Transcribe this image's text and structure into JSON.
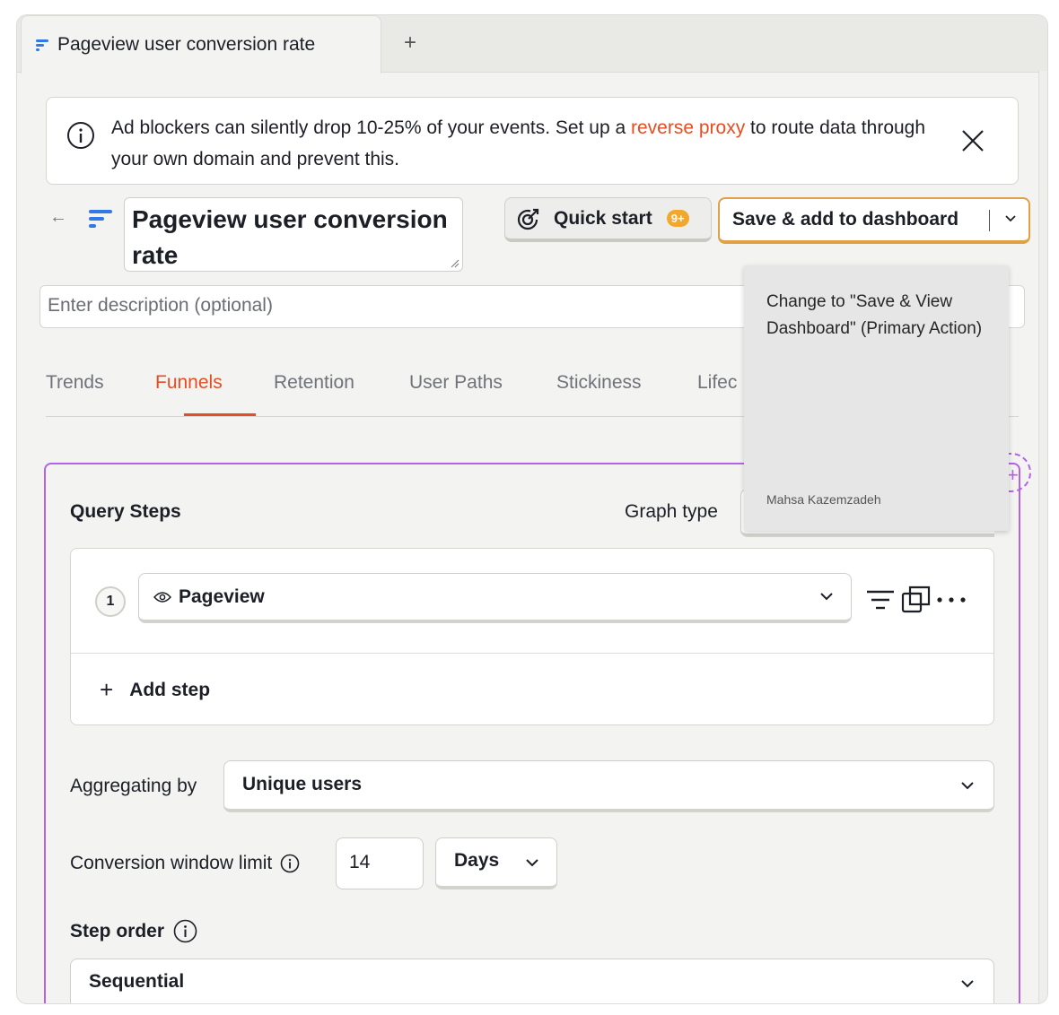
{
  "tab": {
    "label": "Pageview user conversion rate",
    "new_tab": "+"
  },
  "banner": {
    "text_before": "Ad blockers can silently drop 10-25% of your events. Set up a ",
    "link": "reverse proxy",
    "text_after": " to route data through your own domain and prevent this."
  },
  "insight": {
    "title": "Pageview user conversion rate",
    "description_placeholder": "Enter description (optional)"
  },
  "buttons": {
    "quick_start": "Quick start",
    "quick_start_badge": "9+",
    "save": "Save & add to dashboard"
  },
  "insight_types": [
    "Trends",
    "Funnels",
    "Retention",
    "User Paths",
    "Stickiness",
    "Lifec"
  ],
  "active_type": "Funnels",
  "query": {
    "steps_title": "Query Steps",
    "graph_type_label": "Graph type",
    "step_number": "1",
    "step_event": "Pageview",
    "add_step": "Add step",
    "aggregating_label": "Aggregating by",
    "aggregating_value": "Unique users",
    "conversion_label": "Conversion window limit",
    "conversion_value": "14",
    "conversion_unit": "Days",
    "step_order_label": "Step order",
    "step_order_value": "Sequential"
  },
  "tooltip": {
    "text": "Change to \"Save & View Dashboard\" (Primary Action)",
    "author": "Mahsa Kazemzadeh"
  },
  "colors": {
    "accent": "#e54d22",
    "primary_border": "#e0a045",
    "editor_border": "#b462e6",
    "funnel_icon": "#3079e6"
  }
}
